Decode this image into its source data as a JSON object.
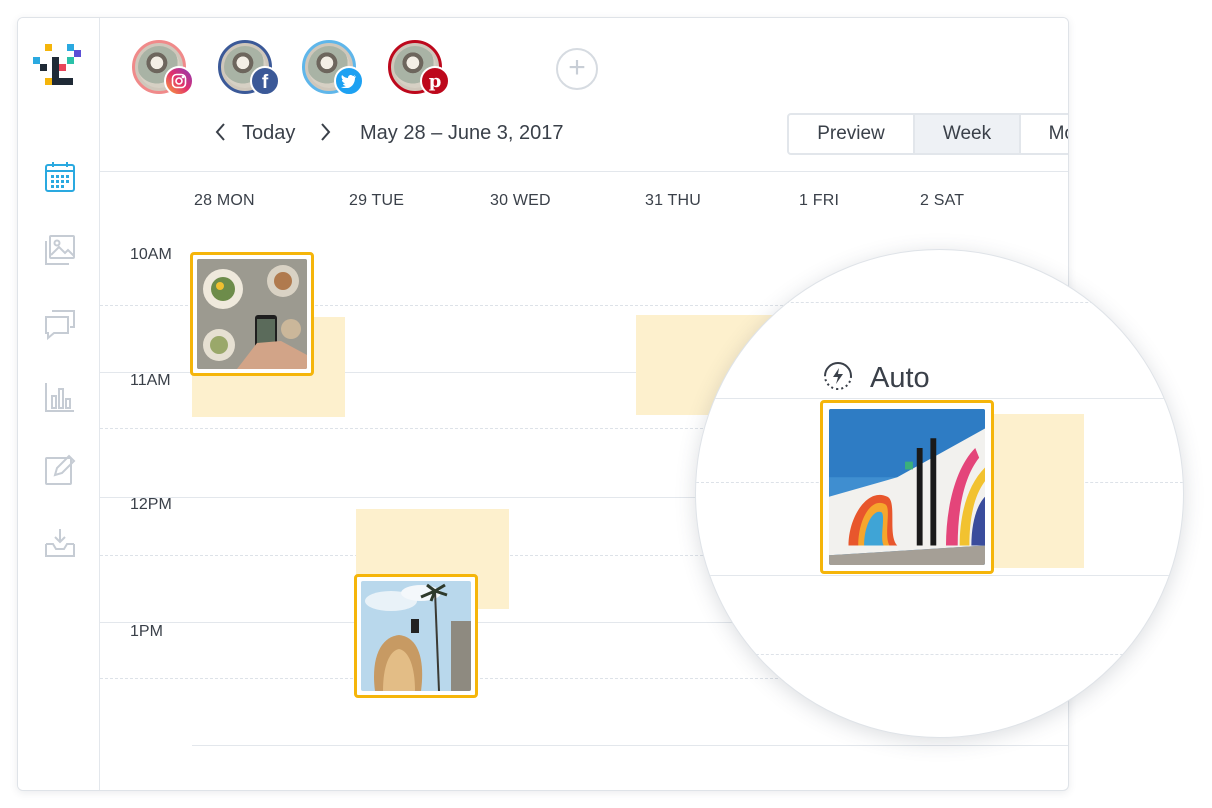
{
  "nav": {
    "date": {
      "prev_icon": "chevron-left-icon",
      "today": "Today",
      "next_icon": "chevron-right-icon",
      "range": "May 28 – June 3, 2017"
    }
  },
  "accounts": [
    {
      "network": "instagram",
      "color": "#d63b6b"
    },
    {
      "network": "facebook",
      "color": "#3b5998"
    },
    {
      "network": "twitter",
      "color": "#1da1f2"
    },
    {
      "network": "pinterest",
      "color": "#bd081c"
    }
  ],
  "views": [
    "Preview",
    "Week",
    "Month"
  ],
  "active_view": "Week",
  "days": [
    "28 MON",
    "29 TUE",
    "30 WED",
    "31 THU",
    "1 FRI",
    "2 SAT"
  ],
  "hours": [
    "10AM",
    "11AM",
    "12PM",
    "1PM"
  ],
  "magnifier": {
    "auto_label": "Auto",
    "auto_icon": "auto-publish-icon"
  },
  "colors": {
    "accent": "#f5b50a",
    "slot": "#fdf0cd",
    "primary": "#2aa9e0"
  }
}
